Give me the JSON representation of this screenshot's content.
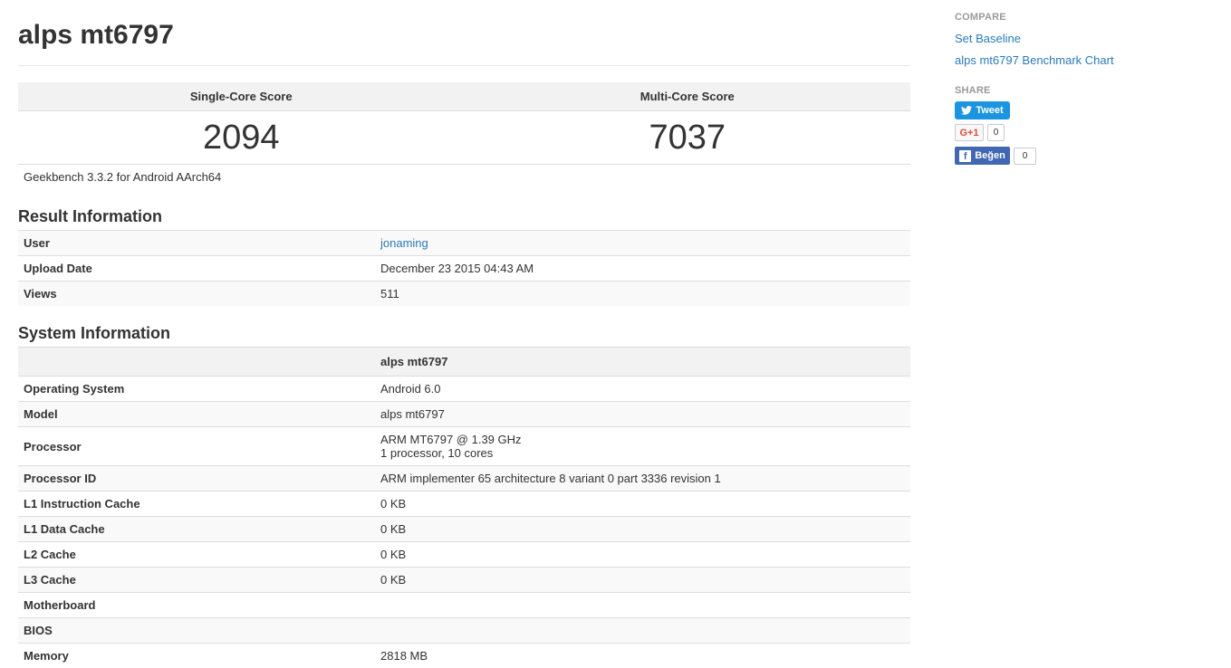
{
  "page": {
    "title": "alps mt6797",
    "version": "Geekbench 3.3.2 for Android AArch64"
  },
  "scores": {
    "single_label": "Single-Core Score",
    "multi_label": "Multi-Core Score",
    "single_value": "2094",
    "multi_value": "7037"
  },
  "result_info": {
    "heading": "Result Information",
    "rows": [
      {
        "label": "User",
        "value": "jonaming"
      },
      {
        "label": "Upload Date",
        "value": "December 23 2015 04:43 AM"
      },
      {
        "label": "Views",
        "value": "511"
      }
    ]
  },
  "system_info": {
    "heading": "System Information",
    "column_header": "alps mt6797",
    "rows": [
      {
        "label": "Operating System",
        "value": "Android 6.0"
      },
      {
        "label": "Model",
        "value": "alps mt6797"
      },
      {
        "label": "Processor",
        "value": "ARM MT6797 @ 1.39 GHz",
        "value2": "1 processor, 10 cores"
      },
      {
        "label": "Processor ID",
        "value": "ARM implementer 65 architecture 8 variant 0 part 3336 revision 1"
      },
      {
        "label": "L1 Instruction Cache",
        "value": "0 KB"
      },
      {
        "label": "L1 Data Cache",
        "value": "0 KB"
      },
      {
        "label": "L2 Cache",
        "value": "0 KB"
      },
      {
        "label": "L3 Cache",
        "value": "0 KB"
      },
      {
        "label": "Motherboard",
        "value": ""
      },
      {
        "label": "BIOS",
        "value": ""
      },
      {
        "label": "Memory",
        "value": "2818 MB"
      }
    ]
  },
  "sidebar": {
    "compare_heading": "COMPARE",
    "set_baseline": "Set Baseline",
    "benchmark_chart": "alps mt6797 Benchmark Chart",
    "share_heading": "SHARE",
    "tweet_label": "Tweet",
    "gplus_label": "G+1",
    "gplus_count": "0",
    "fb_label": "Beğen",
    "fb_count": "0"
  },
  "icons": {
    "tweet": "twitter-bird-icon",
    "gplus": "google-plus-icon",
    "fb": "facebook-f-icon"
  },
  "colors": {
    "link": "#2a7ab9",
    "twitter": "#1b95e0",
    "facebook": "#4267b2",
    "gplus": "#dd4b39"
  }
}
